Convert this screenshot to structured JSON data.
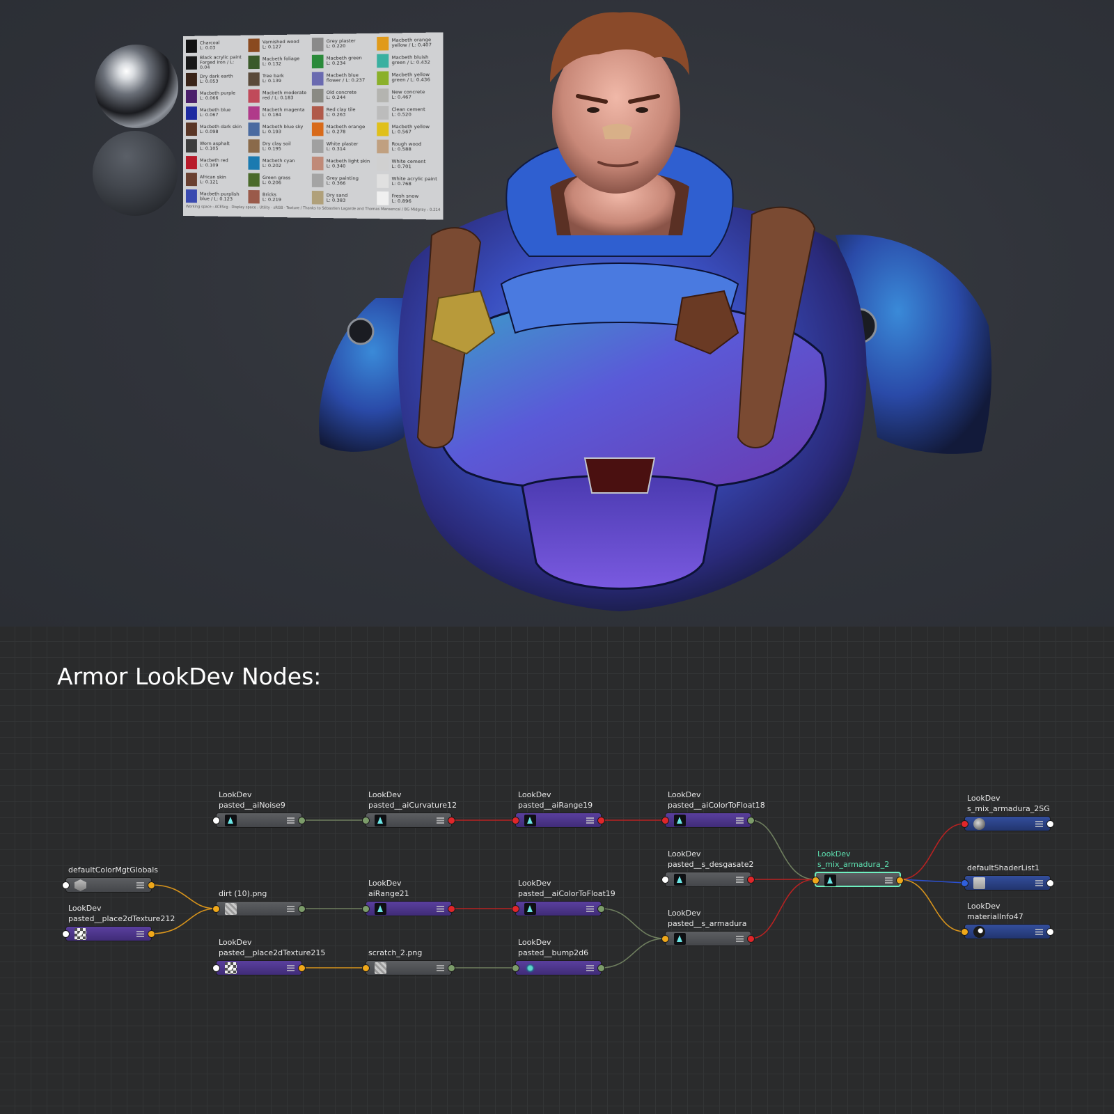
{
  "render_view": {
    "reference": {
      "footer_text": "Working space : ACEScg · Display space : Utility · sRGB · Texture / Thanks to Sébastien Lagarde and Thomas Mansencal / BG Midgray : 0.21404",
      "swatches": [
        {
          "label": "Charcoal\nL: 0.03",
          "color": "#121212"
        },
        {
          "label": "Black acrylic paint\nForged iron / L: 0.04",
          "color": "#181818"
        },
        {
          "label": "Dry dark earth\nL: 0.053",
          "color": "#3a2418"
        },
        {
          "label": "Macbeth purple\nL: 0.066",
          "color": "#4a1e6a"
        },
        {
          "label": "Macbeth blue\nL: 0.067",
          "color": "#1e2aa0"
        },
        {
          "label": "Macbeth dark skin\nL: 0.098",
          "color": "#5a3626"
        },
        {
          "label": "Worn asphalt\nL: 0.105",
          "color": "#3c3c3c"
        },
        {
          "label": "Macbeth red\nL: 0.109",
          "color": "#b81a2a"
        },
        {
          "label": "African skin\nL: 0.121",
          "color": "#6a4030"
        },
        {
          "label": "Macbeth purplish\nblue / L: 0.123",
          "color": "#3a4ab0"
        },
        {
          "label": "Varnished wood\nL: 0.127",
          "color": "#8a4a20"
        },
        {
          "label": "Macbeth foliage\nL: 0.132",
          "color": "#3a5a2a"
        },
        {
          "label": "Tree bark\nL: 0.139",
          "color": "#5a4a3a"
        },
        {
          "label": "Macbeth moderate\nred / L: 0.183",
          "color": "#c04a5a"
        },
        {
          "label": "Macbeth magenta\nL: 0.184",
          "color": "#b03a8a"
        },
        {
          "label": "Macbeth blue sky\nL: 0.193",
          "color": "#4a6aa0"
        },
        {
          "label": "Dry clay soil\nL: 0.195",
          "color": "#8a6a4a"
        },
        {
          "label": "Macbeth cyan\nL: 0.202",
          "color": "#1a7ab0"
        },
        {
          "label": "Green grass\nL: 0.206",
          "color": "#4a6a2a"
        },
        {
          "label": "Bricks\nL: 0.219",
          "color": "#9a5a4a"
        },
        {
          "label": "Grey plaster\nL: 0.220",
          "color": "#8a8a8a"
        },
        {
          "label": "Macbeth green\nL: 0.234",
          "color": "#2a8a3a"
        },
        {
          "label": "Macbeth blue\nflower / L: 0.237",
          "color": "#6a6ab0"
        },
        {
          "label": "Old concrete\nL: 0.244",
          "color": "#8a8a84"
        },
        {
          "label": "Red clay tile\nL: 0.263",
          "color": "#b05a4a"
        },
        {
          "label": "Macbeth orange\nL: 0.278",
          "color": "#d86a1a"
        },
        {
          "label": "White plaster\nL: 0.314",
          "color": "#a0a0a0"
        },
        {
          "label": "Macbeth light skin\nL: 0.340",
          "color": "#c08a78"
        },
        {
          "label": "Grey painting\nL: 0.366",
          "color": "#a4a4a4"
        },
        {
          "label": "Dry sand\nL: 0.383",
          "color": "#b0a07a"
        },
        {
          "label": "Macbeth orange\nyellow / L: 0.407",
          "color": "#e09a1a"
        },
        {
          "label": "Macbeth bluish\ngreen / L: 0.432",
          "color": "#3ab0a0"
        },
        {
          "label": "Macbeth yellow\ngreen / L: 0.436",
          "color": "#8ab02a"
        },
        {
          "label": "New concrete\nL: 0.467",
          "color": "#b4b4b0"
        },
        {
          "label": "Clean cement\nL: 0.520",
          "color": "#bcbcbc"
        },
        {
          "label": "Macbeth yellow\nL: 0.567",
          "color": "#e0c01a"
        },
        {
          "label": "Rough wood\nL: 0.588",
          "color": "#c0a080"
        },
        {
          "label": "White cement\nL: 0.701",
          "color": "#d0d0d0"
        },
        {
          "label": "White acrylic paint\nL: 0.768",
          "color": "#e0e0e0"
        },
        {
          "label": "Fresh snow\nL: 0.896",
          "color": "#f0f0f0"
        }
      ]
    }
  },
  "node_editor": {
    "title": "Armor LookDev Nodes:",
    "colors": {
      "node_grey": "#4f5155",
      "node_purple": "#4a3488",
      "node_blue": "#2a3f84",
      "selected_outline": "#6ff0c0",
      "wire_green": "#6f7f5f",
      "wire_red": "#b82222",
      "wire_yellow": "#d8941c",
      "wire_blue": "#2a4fd0",
      "wire_mix": "#8a6a3a"
    },
    "nodes": {
      "ainoise9": {
        "label": "LookDev\npasted__aiNoise9",
        "icon": "arnold-icon"
      },
      "aicurvature12": {
        "label": "LookDev\npasted__aiCurvature12",
        "icon": "arnold-icon"
      },
      "airange19": {
        "label": "LookDev\npasted__aiRange19",
        "icon": "arnold-icon"
      },
      "aicolortofloat18": {
        "label": "LookDev\npasted__aiColorToFloat18",
        "icon": "arnold-icon"
      },
      "s_mix_armadura_2sg": {
        "label": "LookDev\ns_mix_armadura_2SG",
        "icon": "shading-group-icon"
      },
      "defaultcolormgtglobals": {
        "label": "defaultColorMgtGlobals",
        "icon": "color-management-icon"
      },
      "place2dtexture212": {
        "label": "LookDev\npasted__place2dTexture212",
        "icon": "place2d-icon"
      },
      "dirt10": {
        "label": "dirt (10).png",
        "icon": "texture-icon"
      },
      "airange21": {
        "label": "LookDev\naiRange21",
        "icon": "arnold-icon"
      },
      "aicolortofloat19": {
        "label": "LookDev\npasted__aiColorToFloat19",
        "icon": "arnold-icon"
      },
      "s_desgasate2": {
        "label": "LookDev\npasted__s_desgasate2",
        "icon": "arnold-icon"
      },
      "s_mix_armadura_2": {
        "label": "LookDev\ns_mix_armadura_2",
        "icon": "arnold-icon"
      },
      "defaultshaderlist1": {
        "label": "defaultShaderList1",
        "icon": "shader-list-icon"
      },
      "s_armadura": {
        "label": "LookDev\npasted__s_armadura",
        "icon": "arnold-icon"
      },
      "materialinfo47": {
        "label": "LookDev\nmaterialInfo47",
        "icon": "material-info-icon"
      },
      "place2dtexture215": {
        "label": "LookDev\npasted__place2dTexture215",
        "icon": "place2d-icon"
      },
      "scratch2": {
        "label": "scratch_2.png",
        "icon": "texture-icon"
      },
      "bump2d6": {
        "label": "LookDev\npasted__bump2d6",
        "icon": "bump-icon"
      }
    }
  }
}
